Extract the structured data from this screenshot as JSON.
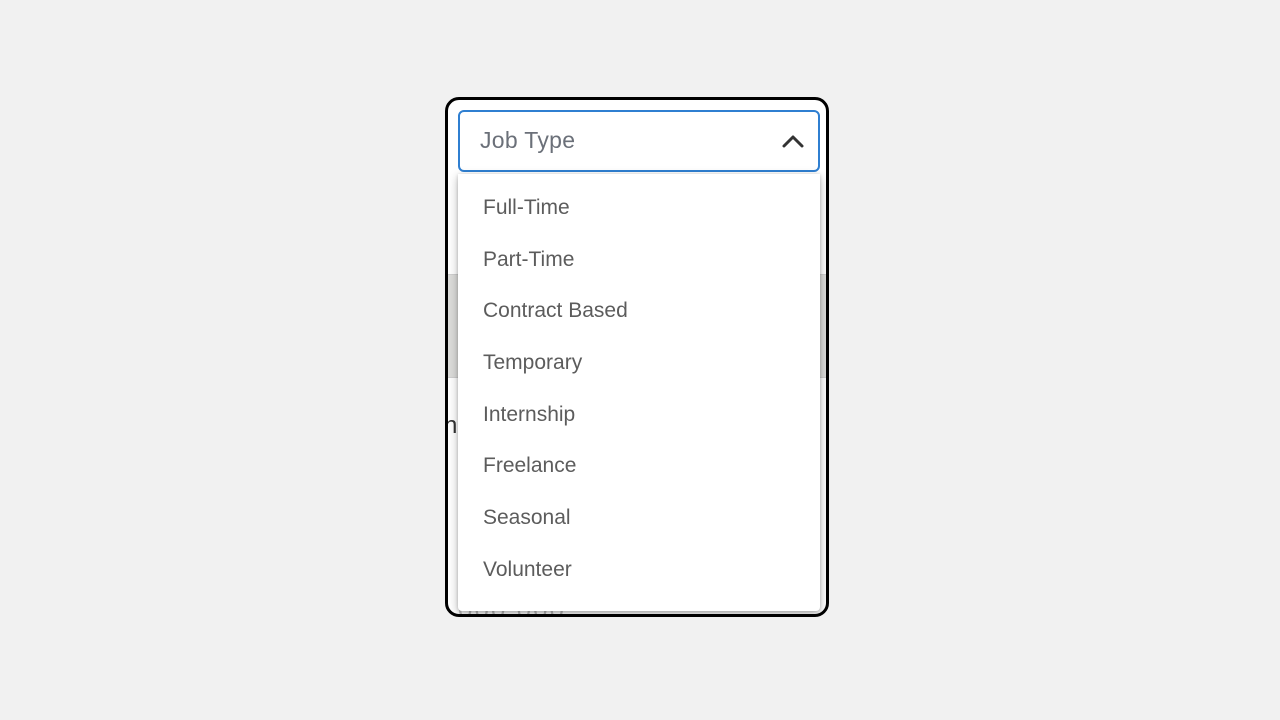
{
  "dropdown": {
    "label": "Job Type",
    "expanded": true,
    "chevron_icon": "chevron-up-icon",
    "accent_color": "#2f7fd1",
    "options": [
      "Full-Time",
      "Part-Time",
      "Contract Based",
      "Temporary",
      "Internship",
      "Freelance",
      "Seasonal",
      "Volunteer"
    ]
  }
}
